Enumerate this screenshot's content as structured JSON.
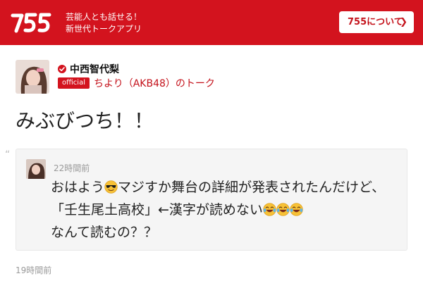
{
  "header": {
    "logo_text": "755",
    "tagline_line1": "芸能人とも話せる！",
    "tagline_line2": "新世代トークアプリ",
    "about_label": "755について"
  },
  "profile": {
    "name": "中西智代梨",
    "badge": "official",
    "talk_title": "ちより（AKB48）のトーク"
  },
  "post": {
    "title": "みぶびつち！！"
  },
  "quoted": {
    "time": "22時間前",
    "text_part1": "おはよう",
    "text_part2": "マジすか舞台の詳細が発表されたんだけど、「壬生尾土高校」←漢字が読めない",
    "text_part3": "なんて読むの？？"
  },
  "footer": {
    "time": "19時間前"
  },
  "colors": {
    "brand_red": "#d3131e",
    "card_bg": "#f5f5f5"
  },
  "icons": [
    "755-logo",
    "chevron-right-icon",
    "verified-check-icon",
    "quote-icon",
    "sunglasses-emoji",
    "tears-of-joy-emoji"
  ]
}
